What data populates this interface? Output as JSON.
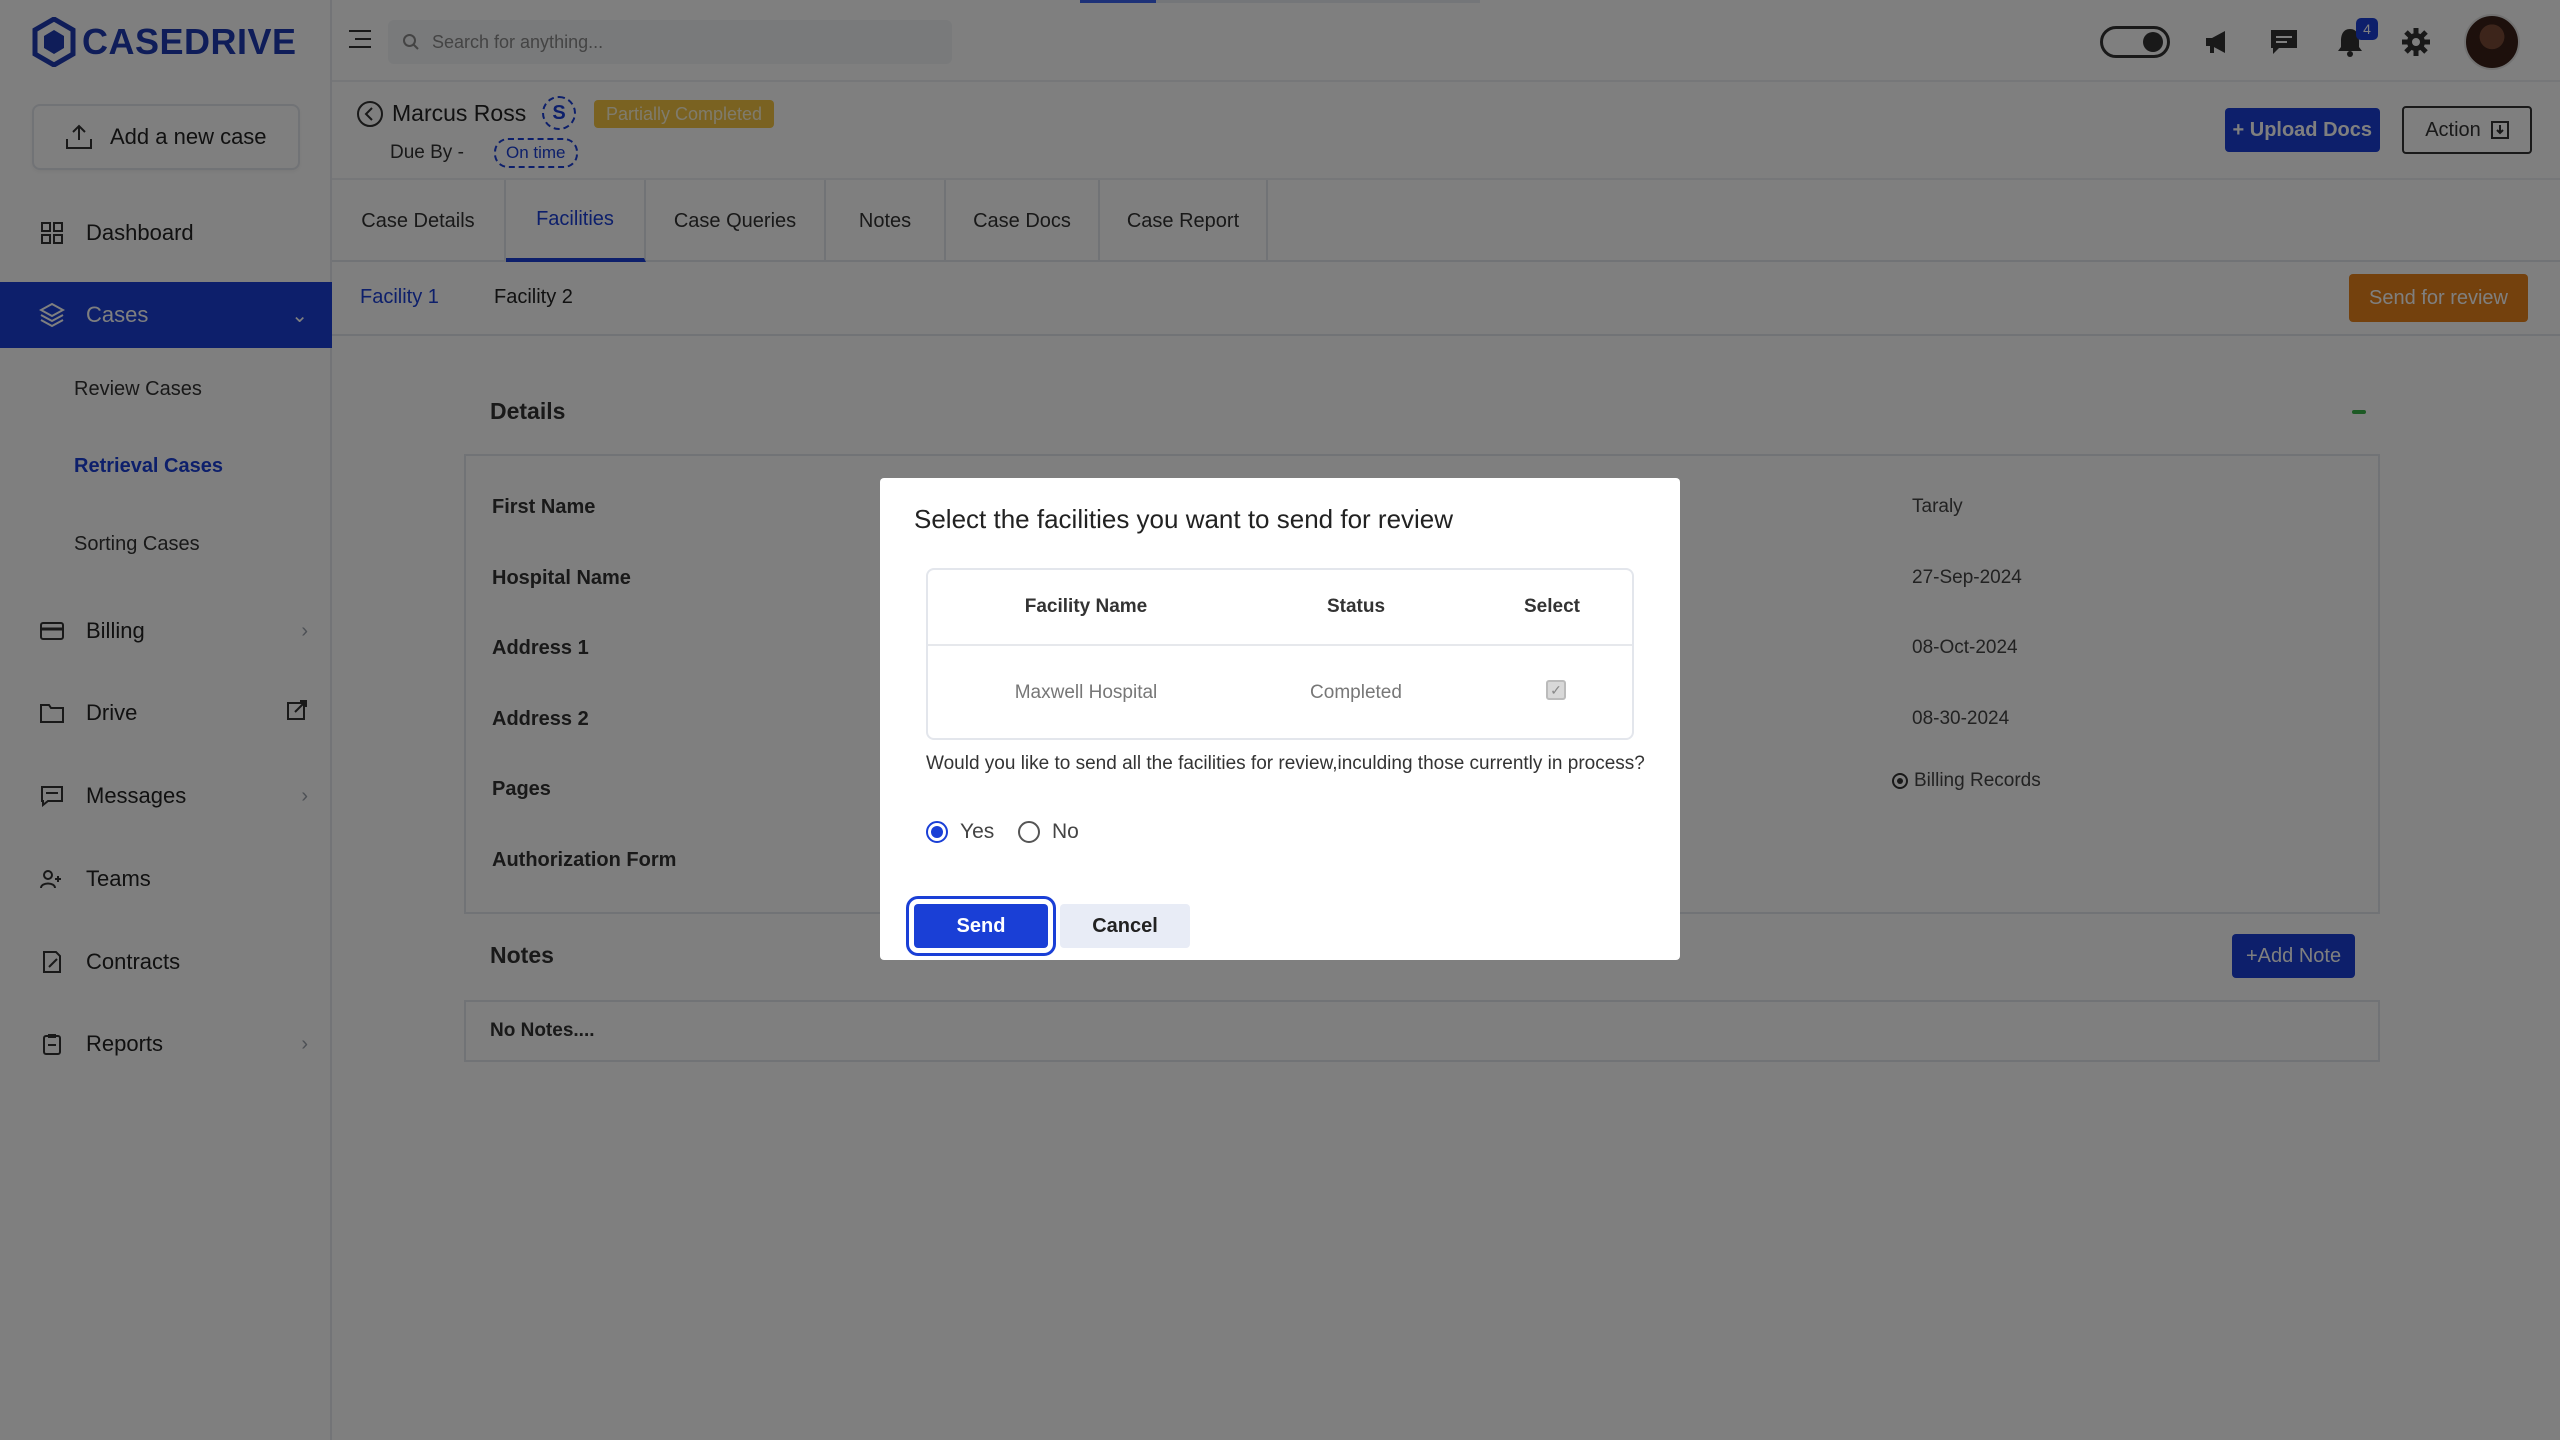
{
  "app": {
    "logo_text": "CASEDRIVE",
    "accent_color": "#1a3fd6"
  },
  "sidebar": {
    "add_case_label": "Add a new case",
    "items": [
      {
        "label": "Dashboard",
        "icon": "grid-icon"
      },
      {
        "label": "Cases",
        "icon": "layers-icon",
        "active": true
      },
      {
        "label": "Billing",
        "icon": "card-icon"
      },
      {
        "label": "Drive",
        "icon": "folder-icon"
      },
      {
        "label": "Messages",
        "icon": "message-icon"
      },
      {
        "label": "Teams",
        "icon": "users-icon"
      },
      {
        "label": "Contracts",
        "icon": "contract-icon"
      },
      {
        "label": "Reports",
        "icon": "report-icon"
      }
    ],
    "sub_items": [
      {
        "label": "Review Cases"
      },
      {
        "label": "Retrieval Cases",
        "active": true
      },
      {
        "label": "Sorting Cases"
      }
    ]
  },
  "topbar": {
    "search_placeholder": "Search for anything...",
    "notification_count": "4",
    "loading_progress": 0.19
  },
  "case": {
    "name": "Marcus Ross",
    "initial": "S",
    "status": "Partially Completed",
    "due_by_label": "Due By -",
    "due_status": "On time",
    "upload_label": "+ Upload Docs",
    "action_label": "Action"
  },
  "tabs": [
    "Case Details",
    "Facilities",
    "Case Queries",
    "Notes",
    "Case Docs",
    "Case Report"
  ],
  "subtabs": [
    "Facility 1",
    "Facility 2"
  ],
  "send_for_review_label": "Send for review",
  "details": {
    "title": "Details",
    "labels": [
      "First Name",
      "Hospital Name",
      "Address 1",
      "Address 2",
      "Pages",
      "Authorization Form"
    ],
    "values": [
      "Taraly",
      "27-Sep-2024",
      "08-Oct-2024",
      "08-30-2024"
    ],
    "pages_value": "Billing Records"
  },
  "notes": {
    "title": "Notes",
    "add_label": "+Add Note",
    "empty_text": "No Notes...."
  },
  "modal": {
    "title": "Select the facilities you want to send for review",
    "columns": [
      "Facility Name",
      "Status",
      "Select"
    ],
    "rows": [
      {
        "facility": "Maxwell Hospital",
        "status": "Completed",
        "selected": true
      }
    ],
    "question": "Would you like to send all the facilities for review,inculding those currently in process?",
    "options": [
      "Yes",
      "No"
    ],
    "selected_option": "Yes",
    "send_label": "Send",
    "cancel_label": "Cancel"
  }
}
